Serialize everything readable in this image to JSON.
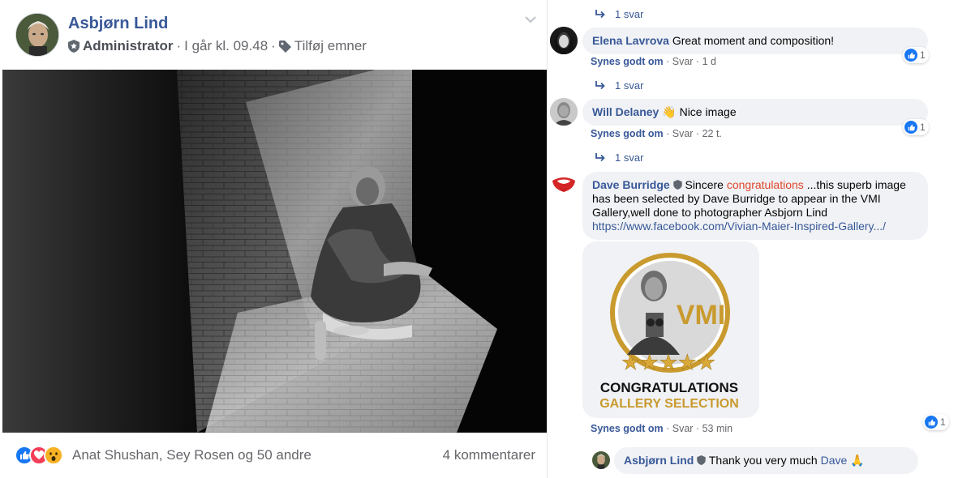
{
  "post": {
    "author": "Asbjørn Lind",
    "role": "Administrator",
    "separator": "·",
    "time": "I går kl. 09.48",
    "tag_label": "Tilføj emner",
    "reactors": "Anat Shushan, Sey Rosen og 50 andre",
    "comment_count": "4 kommentarer"
  },
  "icons": {
    "like": "like-icon",
    "love": "love-icon",
    "wow": "wow-icon",
    "shield": "shield-icon",
    "tag": "tag-icon",
    "reply": "reply-arrow-icon"
  },
  "colors": {
    "link_blue": "#385898",
    "like_blue": "#1877f2",
    "love_red": "#f33e58",
    "wow_yellow": "#f7b125",
    "highlight": "#e0452b",
    "gold": "#c99a2e",
    "bubble_bg": "#f0f2f5"
  },
  "comments": {
    "reply_top": "1 svar",
    "elena": {
      "name": "Elena Lavrova",
      "text": "Great moment and composition!",
      "like": "Synes godt om",
      "dot": "·",
      "reply": "Svar",
      "time": "1 d",
      "count": "1",
      "replies": "1 svar"
    },
    "will": {
      "name": "Will Delaney",
      "emoji": "👋",
      "text": "Nice image",
      "like": "Synes godt om",
      "dot": "·",
      "reply": "Svar",
      "time": "22 t.",
      "count": "1",
      "replies": "1 svar"
    },
    "dave": {
      "name": "Dave Burridge",
      "text_before": "Sincere",
      "highlight": "congratulations",
      "text_after": "...this superb image has been selected by Dave Burridge to appear in the VMI Gallery,well done to photographer Asbjorn Lind",
      "link": "https://www.facebook.com/Vivian-Maier-Inspired-Gallery.../",
      "like": "Synes godt om",
      "dot": "·",
      "reply": "Svar",
      "time": "53 min",
      "count": "1",
      "card": {
        "badge": "VMI",
        "stars": "★★★★★",
        "line1": "CONGRATULATIONS",
        "line2": "GALLERY SELECTION"
      }
    },
    "asbjorn": {
      "name": "Asbjørn Lind",
      "text": "Thank you very much",
      "mention": "Dave",
      "emoji": "🙏"
    }
  }
}
